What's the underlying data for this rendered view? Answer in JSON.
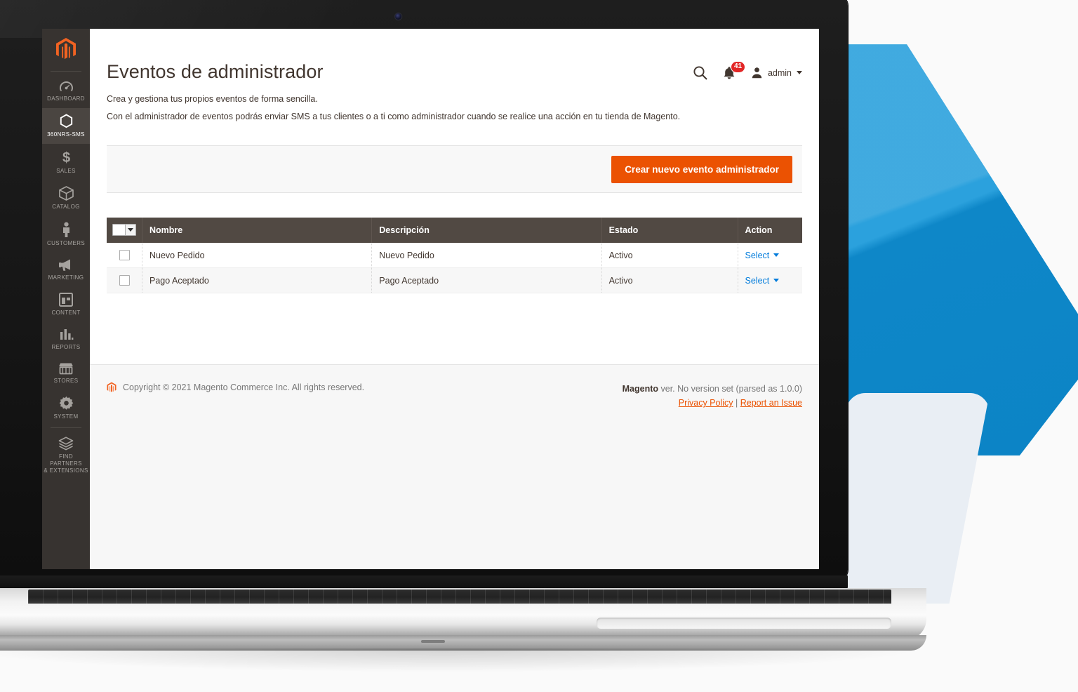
{
  "sidebar": {
    "logo_icon": "magento-logo-icon",
    "items": [
      {
        "label": "DASHBOARD",
        "icon": "dashboard-gauge-icon",
        "active": false
      },
      {
        "label": "360NRS-SMS",
        "icon": "hexagon-icon",
        "active": true
      },
      {
        "label": "SALES",
        "icon": "dollar-icon",
        "active": false
      },
      {
        "label": "CATALOG",
        "icon": "box-icon",
        "active": false
      },
      {
        "label": "CUSTOMERS",
        "icon": "person-icon",
        "active": false
      },
      {
        "label": "MARKETING",
        "icon": "megaphone-icon",
        "active": false
      },
      {
        "label": "CONTENT",
        "icon": "layout-icon",
        "active": false
      },
      {
        "label": "REPORTS",
        "icon": "bar-chart-icon",
        "active": false
      },
      {
        "label": "STORES",
        "icon": "storefront-icon",
        "active": false
      },
      {
        "label": "SYSTEM",
        "icon": "gear-icon",
        "active": false
      },
      {
        "label": "FIND PARTNERS\n& EXTENSIONS",
        "icon": "puzzle-box-icon",
        "active": false
      }
    ]
  },
  "header": {
    "title": "Eventos de administrador",
    "desc_line1": "Crea y gestiona tus propios eventos de forma sencilla.",
    "desc_line2": "Con el administrador de eventos podrás enviar SMS a tus clientes o a ti como administrador cuando se realice una acción en tu tienda de Magento.",
    "search_icon": "search-icon",
    "notifications_icon": "bell-icon",
    "notifications_count": "41",
    "user_icon": "user-avatar-icon",
    "user_name": "admin"
  },
  "actions": {
    "create_button": "Crear nuevo evento administrador"
  },
  "grid": {
    "columns": [
      "Nombre",
      "Descripción",
      "Estado",
      "Action"
    ],
    "rows": [
      {
        "nombre": "Nuevo Pedido",
        "descripcion": "Nuevo Pedido",
        "estado": "Activo",
        "action": "Select"
      },
      {
        "nombre": "Pago Aceptado",
        "descripcion": "Pago Aceptado",
        "estado": "Activo",
        "action": "Select"
      }
    ]
  },
  "footer": {
    "copyright": "Copyright © 2021 Magento Commerce Inc. All rights reserved.",
    "version_brand": "Magento",
    "version_text": " ver. No version set (parsed as 1.0.0)",
    "privacy_policy": "Privacy Policy",
    "separator": "|",
    "report_issue": "Report an Issue"
  },
  "theme": {
    "accent": "#eb5202",
    "sidebar_bg": "#373330",
    "table_header_bg": "#514943",
    "link_blue": "#007bdb",
    "badge_red": "#e22626",
    "shape_blue": "#0e87c8",
    "shape_pale": "#e9eef4"
  }
}
